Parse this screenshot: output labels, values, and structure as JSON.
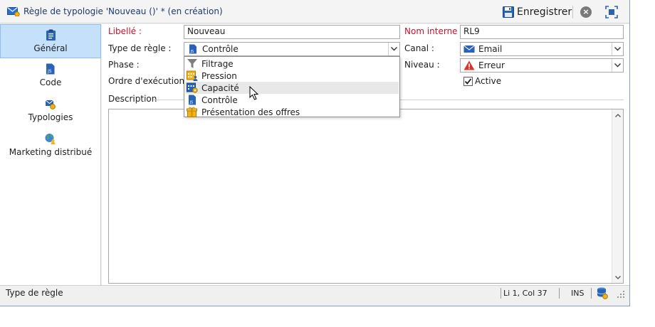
{
  "window": {
    "title": "Règle de typologie 'Nouveau ()' * (en création)",
    "save_label": "Enregistrer",
    "cancel_icon": "close-circle-icon",
    "expand_icon": "fullscreen-icon"
  },
  "sidebar": {
    "items": [
      {
        "label": "Général",
        "icon": "clipboard-icon",
        "active": true
      },
      {
        "label": "Code",
        "icon": "js-file-icon"
      },
      {
        "label": "Typologies",
        "icon": "typology-icon"
      },
      {
        "label": "Marketing distribué",
        "icon": "globe-user-icon"
      }
    ]
  },
  "form": {
    "libelle_label": "Libellé :",
    "libelle_value": "Nouveau",
    "nom_interne_label": "Nom interne :",
    "nom_interne_value": "RL9",
    "type_regle_label": "Type de règle :",
    "type_regle_value": "Contrôle",
    "canal_label": "Canal :",
    "canal_value": "Email",
    "phase_label": "Phase :",
    "niveau_label": "Niveau :",
    "niveau_value": "Erreur",
    "ordre_label": "Ordre d'exécution :",
    "active_label": "Active",
    "active_checked": true,
    "description_label": "Description"
  },
  "dropdown": {
    "items": [
      {
        "label": "Filtrage",
        "icon": "filter-icon"
      },
      {
        "label": "Pression",
        "icon": "calendar-user-icon"
      },
      {
        "label": "Capacité",
        "icon": "calendar-gear-icon",
        "hover": true
      },
      {
        "label": "Contrôle",
        "icon": "js-file-icon"
      },
      {
        "label": "Présentation des offres",
        "icon": "gift-icon"
      }
    ]
  },
  "statusbar": {
    "field_name": "Type de règle",
    "position": "Li 1, Col 37",
    "mode": "INS"
  },
  "colors": {
    "required_label": "#c8102e",
    "active_tab_bg": "#c5e0fb",
    "title_text": "#1f3a6b"
  }
}
